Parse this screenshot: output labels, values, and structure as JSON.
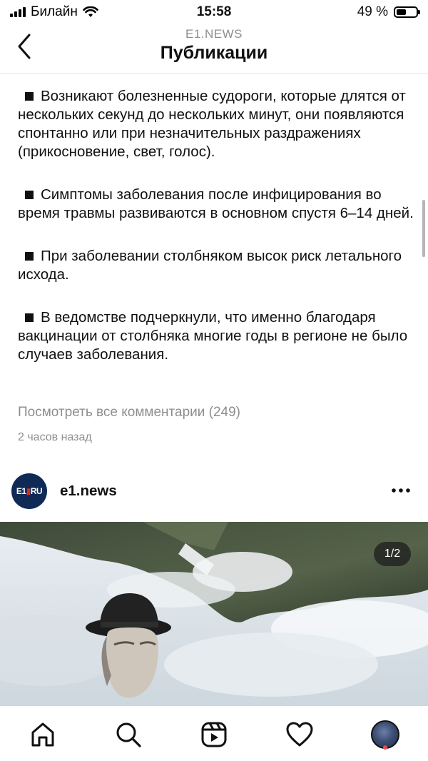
{
  "status_bar": {
    "carrier": "Билайн",
    "time": "15:58",
    "battery": "49 %",
    "battery_level": 0.49
  },
  "header": {
    "subtitle": "E1.NEWS",
    "title": "Публикации"
  },
  "caption": {
    "paragraphs": [
      "Возникают болезненные судороги, которые длятся от нескольких секунд до нескольких минут, они появляются спонтанно или при незначительных раздражениях (прикосновение, свет, голос).",
      "Симптомы заболевания после инфицирования во время травмы развиваются в основном спустя 6–14 дней.",
      "При заболевании столбняком высок риск летального исхода.",
      "В ведомстве подчеркнули, что именно благодаря вакцинации от столбняка многие годы в регионе не было случаев заболевания."
    ],
    "view_comments": "Посмотреть все комментарии (249)",
    "time_ago": "2 часов назад"
  },
  "next_post": {
    "avatar_text": "E1",
    "avatar_suffix": "RU",
    "username": "e1.news",
    "page_indicator": "1/2"
  },
  "tab_bar": {
    "items": [
      "home-icon",
      "search-icon",
      "reels-icon",
      "heart-icon",
      "profile-avatar"
    ]
  }
}
